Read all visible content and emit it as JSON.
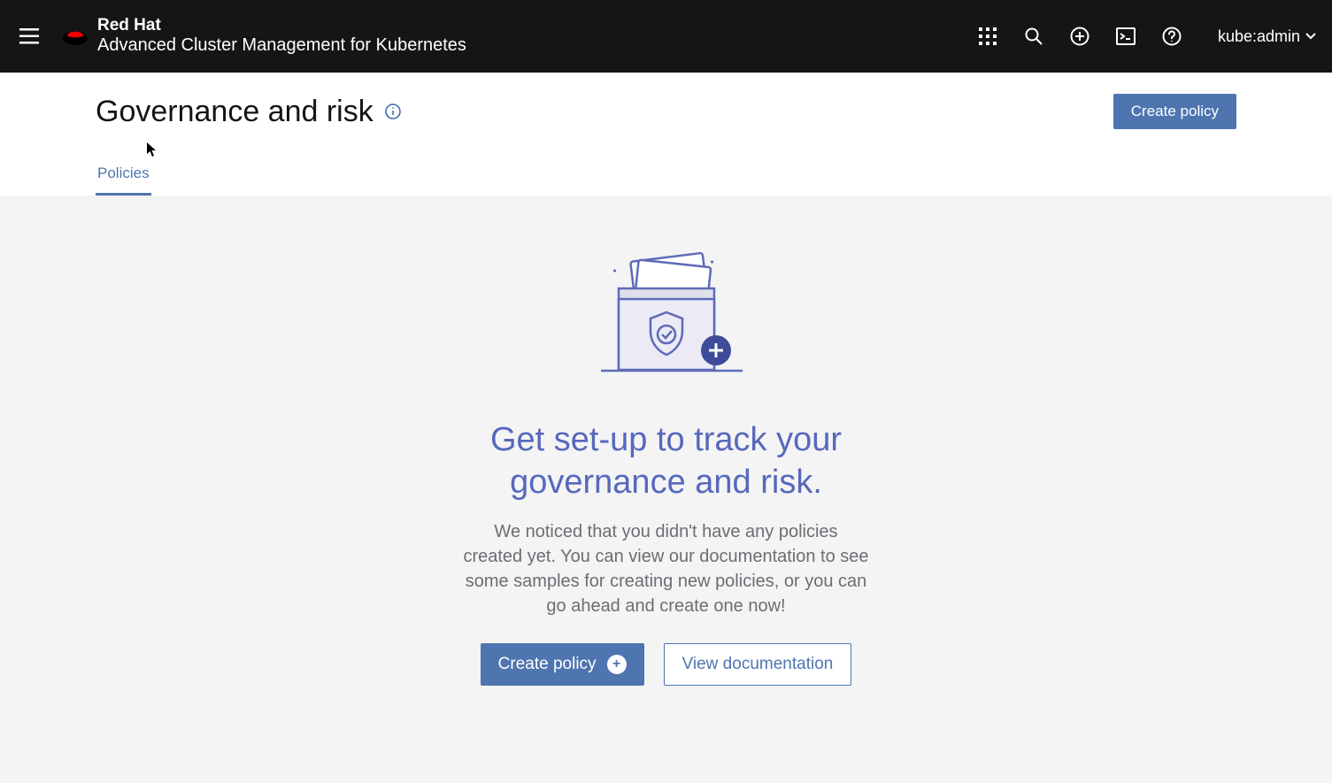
{
  "header": {
    "brand_name": "Red Hat",
    "product_name": "Advanced Cluster Management for Kubernetes",
    "user_label": "kube:admin"
  },
  "page": {
    "title": "Governance and risk",
    "create_button": "Create policy"
  },
  "tabs": {
    "policies": "Policies"
  },
  "empty_state": {
    "heading": "Get set-up to track your governance and risk.",
    "body": "We noticed that you didn't have any policies created yet. You can view our documentation to see some samples for creating new policies, or you can go ahead and create one now!",
    "create_label": "Create policy",
    "docs_label": "View documentation"
  }
}
